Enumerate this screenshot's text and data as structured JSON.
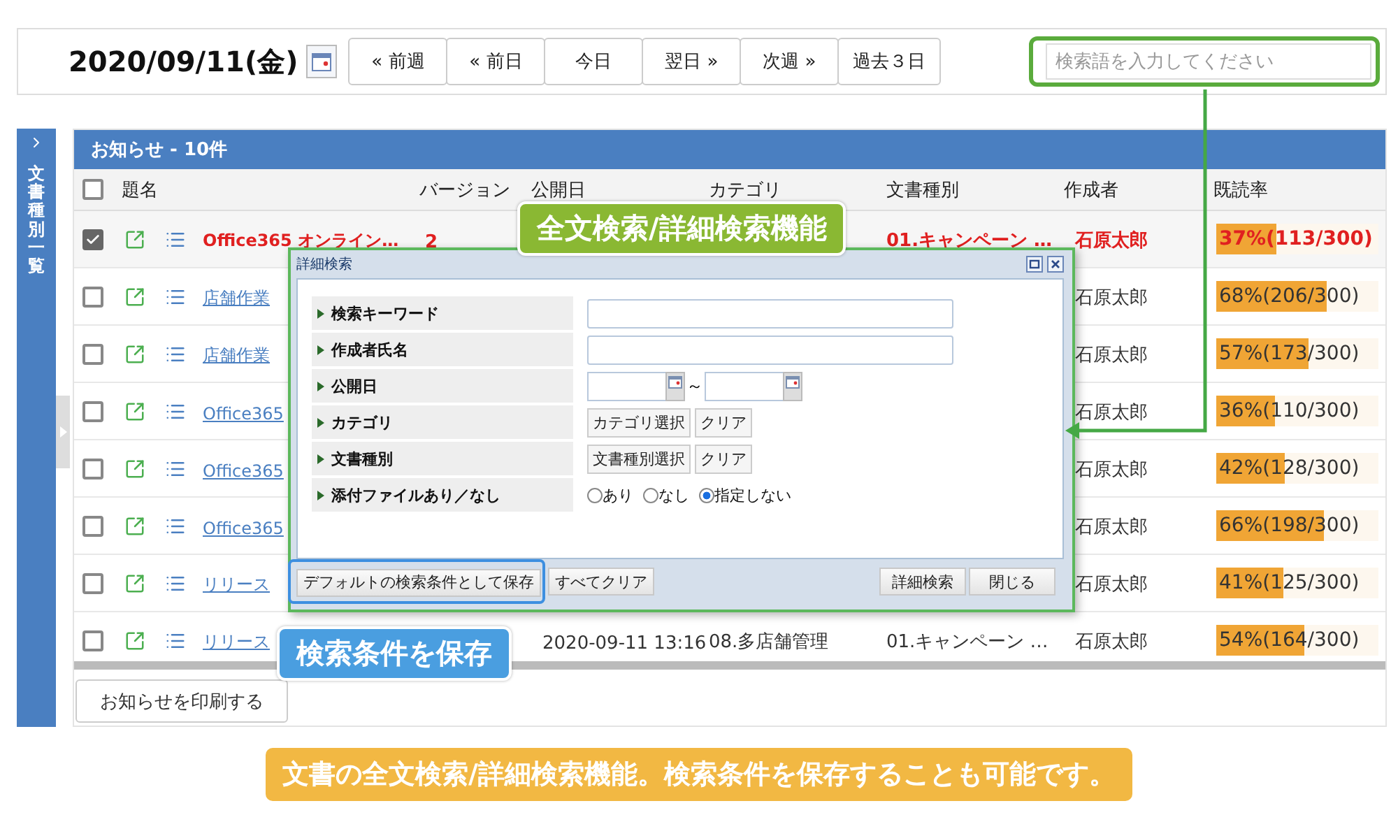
{
  "toolbar": {
    "date": "2020/09/11(金)",
    "nav_buttons": [
      "« 前週",
      "« 前日",
      "今日",
      "翌日 »",
      "次週 »",
      "過去３日"
    ],
    "search": {
      "placeholder": "検索語を入力してください"
    }
  },
  "sidebar": {
    "title": "文書種別一覧"
  },
  "notices": {
    "title": "お知らせ - 10件",
    "header_checked": false,
    "columns": [
      "題名",
      "バージョン",
      "公開日",
      "カテゴリ",
      "文書種別",
      "作成者",
      "既読率"
    ],
    "rows": [
      {
        "checked": true,
        "emphasis": true,
        "title": "Office365 オンライン…",
        "version": "2",
        "doc_type": "01.キャンペーン …",
        "author": "石原太郎",
        "rate": "37%(113/300)",
        "level": 0.37
      },
      {
        "checked": false,
        "emphasis": false,
        "title": "店舗作業",
        "author": "石原太郎",
        "rate": "68%(206/300)",
        "level": 0.68
      },
      {
        "checked": false,
        "emphasis": false,
        "title": "店舗作業",
        "author": "石原太郎",
        "rate": "57%(173/300)",
        "level": 0.57
      },
      {
        "checked": false,
        "emphasis": false,
        "title": "Office365",
        "author": "石原太郎",
        "rate": "36%(110/300)",
        "level": 0.36
      },
      {
        "checked": false,
        "emphasis": false,
        "title": "Office365",
        "author": "石原太郎",
        "rate": "42%(128/300)",
        "level": 0.42
      },
      {
        "checked": false,
        "emphasis": false,
        "title": "Office365",
        "author": "石原太郎",
        "rate": "66%(198/300)",
        "level": 0.66
      },
      {
        "checked": false,
        "emphasis": false,
        "title": "リリース",
        "author": "石原太郎",
        "rate": "41%(125/300)",
        "level": 0.41
      },
      {
        "checked": false,
        "emphasis": false,
        "title": "リリース",
        "published": "2020-09-11 13:16",
        "category": "08.多店舗管理",
        "doc_type": "01.キャンペーン …",
        "author": "石原太郎",
        "rate": "54%(164/300)",
        "level": 0.54
      }
    ],
    "print_button": "お知らせを印刷する"
  },
  "dialog": {
    "title": "詳細検索",
    "fields": [
      {
        "kind": "text",
        "label": "検索キーワード"
      },
      {
        "kind": "text",
        "label": "作成者氏名"
      },
      {
        "kind": "daterange",
        "label": "公開日",
        "separator": "～"
      },
      {
        "kind": "select",
        "label": "カテゴリ",
        "buttons": [
          "カテゴリ選択",
          "クリア"
        ]
      },
      {
        "kind": "select",
        "label": "文書種別",
        "buttons": [
          "文書種別選択",
          "クリア"
        ]
      },
      {
        "kind": "radio",
        "label": "添付ファイルあり／なし",
        "options": [
          {
            "label": "あり",
            "selected": false
          },
          {
            "label": "なし",
            "selected": false
          },
          {
            "label": "指定しない",
            "selected": true
          }
        ]
      }
    ],
    "footer_left": [
      "デフォルトの検索条件として保存",
      "すべてクリア"
    ],
    "footer_right": [
      "詳細検索",
      "閉じる"
    ]
  },
  "callouts": [
    {
      "text": "全文検索/詳細検索機能",
      "color": "#8ab833"
    },
    {
      "text": "検索条件を保存",
      "color": "#4a9ee0"
    }
  ],
  "caption": "文書の全文検索/詳細検索機能。検索条件を保存することも可能です。"
}
